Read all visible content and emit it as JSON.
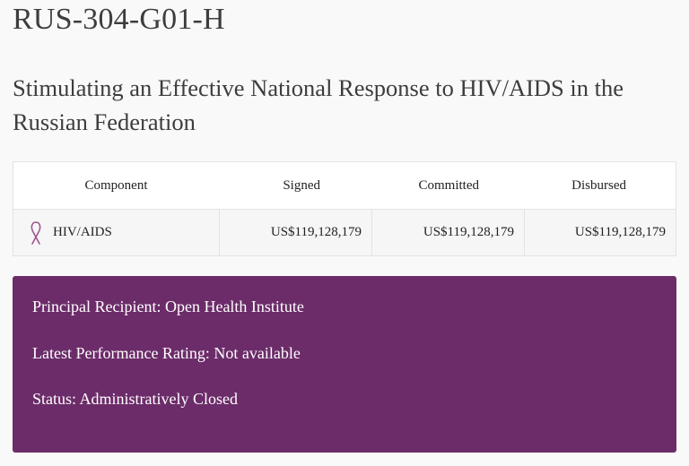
{
  "grant": {
    "id": "RUS-304-G01-H",
    "title": "Stimulating an Effective National Response to HIV/AIDS in the Russian Federation"
  },
  "table": {
    "headers": [
      "Component",
      "Signed",
      "Committed",
      "Disbursed"
    ],
    "rows": [
      {
        "icon": "ribbon-icon",
        "component": "HIV/AIDS",
        "signed": "US$119,128,179",
        "committed": "US$119,128,179",
        "disbursed": "US$119,128,179"
      }
    ]
  },
  "info": {
    "principal_recipient": "Principal Recipient: Open Health Institute",
    "performance_rating": "Latest Performance Rating: Not available",
    "status": "Status: Administratively Closed"
  },
  "colors": {
    "panel_background": "#6c2c69",
    "ribbon": "#a0568f"
  }
}
